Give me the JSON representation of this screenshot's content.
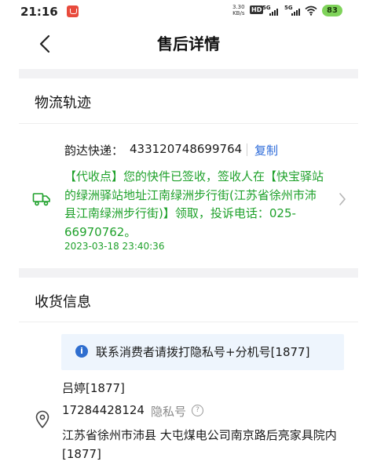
{
  "status_bar": {
    "time": "21:16",
    "net_speed_value": "3.30",
    "net_speed_unit": "KB/s",
    "hd_badge": "HD",
    "signal_1": "5G",
    "signal_2": "5G",
    "battery": "83"
  },
  "header": {
    "title": "售后详情",
    "back_icon": "chevron-left-icon"
  },
  "logistics": {
    "section_title": "物流轨迹",
    "courier_label": "韵达快递：",
    "tracking_number": "433120748699764",
    "copy_label": "复制",
    "latest_status": "【代收点】您的快件已签收，签收人在【快宝驿站的绿洲驿站地址江南绿洲步行街(江苏省徐州市沛县江南绿洲步行街)】领取，投诉电话：025-66970762。",
    "latest_time": "2023-03-18 23:40:36",
    "status_color": "#1fa12b",
    "icon": "truck-icon"
  },
  "receiver": {
    "section_title": "收货信息",
    "notice": "联系消费者请拨打隐私号+分机号[1877]",
    "name": "吕婷[1877]",
    "phone": "17284428124",
    "privacy_label": "隐私号",
    "address": "江苏省徐州市沛县 大屯煤电公司南京路后亮家具院内[1877]",
    "icon": "location-pin-icon"
  },
  "colors": {
    "link": "#2d6bd9",
    "success_green": "#1fa12b",
    "notice_bg": "#eef5fd",
    "info_blue": "#2f6ecf"
  }
}
